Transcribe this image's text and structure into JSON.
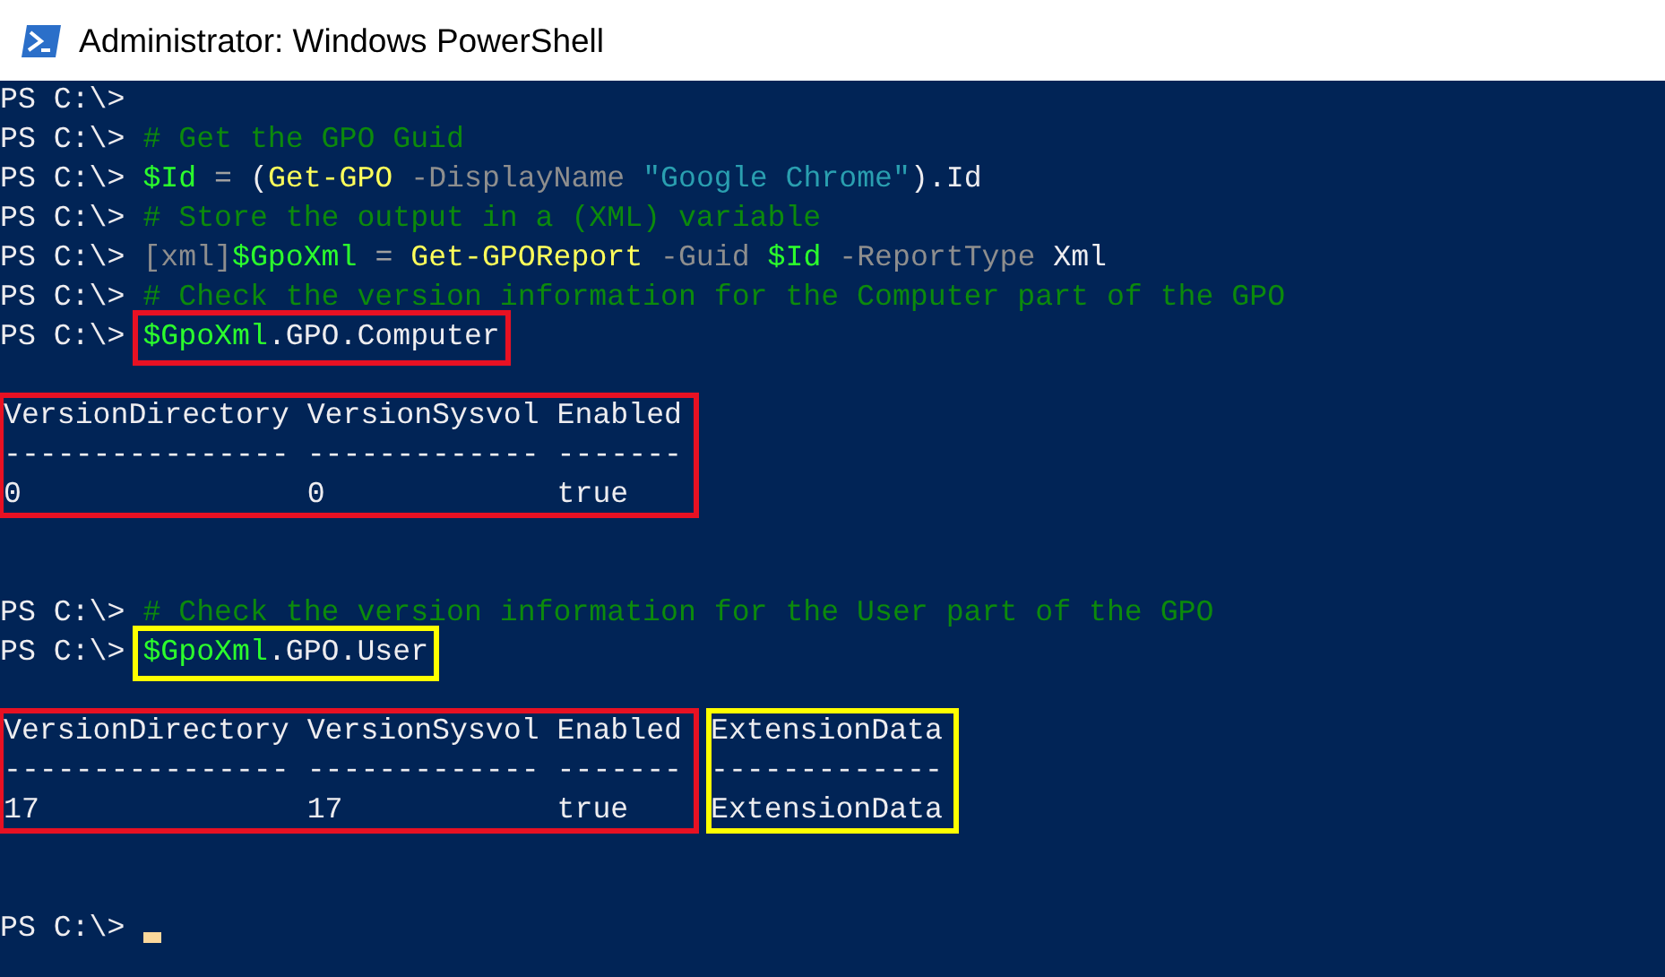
{
  "window": {
    "title": "Administrator: Windows PowerShell"
  },
  "console": [
    {
      "kind": "command",
      "prompt": "PS C:\\>"
    },
    {
      "kind": "command",
      "prompt": "PS C:\\>",
      "segments": [
        {
          "kind": "comment",
          "text": "# Get the GPO Guid"
        }
      ]
    },
    {
      "kind": "command",
      "prompt": "PS C:\\>",
      "segments": [
        {
          "kind": "variable",
          "text": "$Id"
        },
        {
          "kind": "operator",
          "text": " = "
        },
        {
          "kind": "plain",
          "text": "("
        },
        {
          "kind": "cmdlet",
          "text": "Get-GPO"
        },
        {
          "kind": "parameter",
          "text": " -DisplayName "
        },
        {
          "kind": "string",
          "text": "\"Google Chrome\""
        },
        {
          "kind": "plain",
          "text": ").Id"
        }
      ]
    },
    {
      "kind": "command",
      "prompt": "PS C:\\>",
      "segments": [
        {
          "kind": "comment",
          "text": "# Store the output in a (XML) variable"
        }
      ]
    },
    {
      "kind": "command",
      "prompt": "PS C:\\>",
      "segments": [
        {
          "kind": "parameter",
          "text": "[xml]"
        },
        {
          "kind": "variable",
          "text": "$GpoXml"
        },
        {
          "kind": "operator",
          "text": " = "
        },
        {
          "kind": "cmdlet",
          "text": "Get-GPOReport"
        },
        {
          "kind": "parameter",
          "text": " -Guid "
        },
        {
          "kind": "variable",
          "text": "$Id"
        },
        {
          "kind": "parameter",
          "text": " -ReportType "
        },
        {
          "kind": "plain",
          "text": "Xml"
        }
      ]
    },
    {
      "kind": "command",
      "prompt": "PS C:\\>",
      "segments": [
        {
          "kind": "comment",
          "text": "# Check the version information for the Computer part of the GPO"
        }
      ]
    },
    {
      "kind": "command",
      "prompt": "PS C:\\>",
      "color": "#e81123",
      "segments": [
        {
          "kind": "variable",
          "text": "$GpoXml"
        },
        {
          "kind": "plain",
          "text": ".GPO.Computer"
        }
      ]
    },
    {
      "kind": "blank"
    },
    {
      "kind": "table",
      "groups": [
        {
          "color": "#e81123",
          "columns": [
            {
              "header": "VersionDirectory",
              "rule": "----------------",
              "value": "0"
            },
            {
              "header": "VersionSysvol",
              "rule": "-------------",
              "value": "0"
            },
            {
              "header": "Enabled",
              "rule": "-------",
              "value": "true"
            }
          ]
        }
      ]
    },
    {
      "kind": "blank"
    },
    {
      "kind": "blank"
    },
    {
      "kind": "command",
      "prompt": "PS C:\\>",
      "segments": [
        {
          "kind": "comment",
          "text": "# Check the version information for the User part of the GPO"
        }
      ]
    },
    {
      "kind": "command",
      "prompt": "PS C:\\>",
      "color": "#ffff00",
      "segments": [
        {
          "kind": "variable",
          "text": "$GpoXml"
        },
        {
          "kind": "plain",
          "text": ".GPO.User"
        }
      ]
    },
    {
      "kind": "blank"
    },
    {
      "kind": "table",
      "groups": [
        {
          "color": "#e81123",
          "columns": [
            {
              "header": "VersionDirectory",
              "rule": "----------------",
              "value": "17"
            },
            {
              "header": "VersionSysvol",
              "rule": "-------------",
              "value": "17"
            },
            {
              "header": "Enabled",
              "rule": "-------",
              "value": "true"
            }
          ]
        },
        {
          "color": "#ffff00",
          "columns": [
            {
              "header": "ExtensionData",
              "rule": "-------------",
              "value": "ExtensionData"
            }
          ]
        }
      ]
    },
    {
      "kind": "blank"
    },
    {
      "kind": "blank"
    },
    {
      "kind": "command",
      "prompt": "PS C:\\>",
      "cursor": true
    }
  ]
}
